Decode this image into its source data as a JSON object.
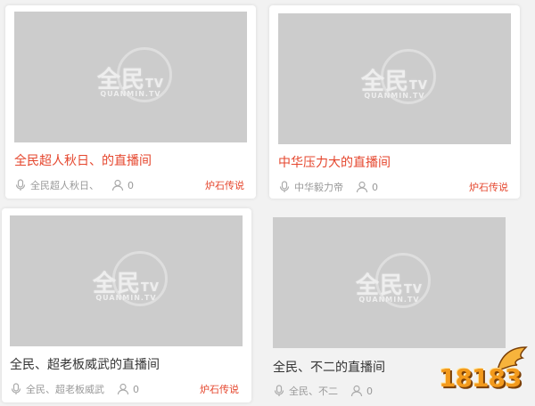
{
  "watermark_logo": {
    "text": "全民",
    "tv": "TV",
    "sub": "QUANMIN.TV"
  },
  "cards": [
    {
      "title": "全民超人秋日、的直播间",
      "streamer": "全民超人秋日、",
      "viewers": "0",
      "category": "炉石传说",
      "title_color": "#e5462d"
    },
    {
      "title": "中华压力大的直播间",
      "streamer": "中华毅力帝",
      "viewers": "0",
      "category": "炉石传说",
      "title_color": "#e5462d"
    },
    {
      "title": "全民、超老板威武的直播间",
      "streamer": "全民、超老板威武",
      "viewers": "0",
      "category": "炉石传说",
      "title_color": "#333333"
    },
    {
      "title": "全民、不二的直播间",
      "streamer": "全民、不二",
      "viewers": "0",
      "category": "",
      "title_color": "#333333"
    }
  ],
  "badge": {
    "text": "18183"
  },
  "icons": {
    "streamer": "microphone-icon",
    "viewers": "user-icon"
  },
  "colors": {
    "accent": "#e5462d",
    "thumb": "#cccccc"
  }
}
